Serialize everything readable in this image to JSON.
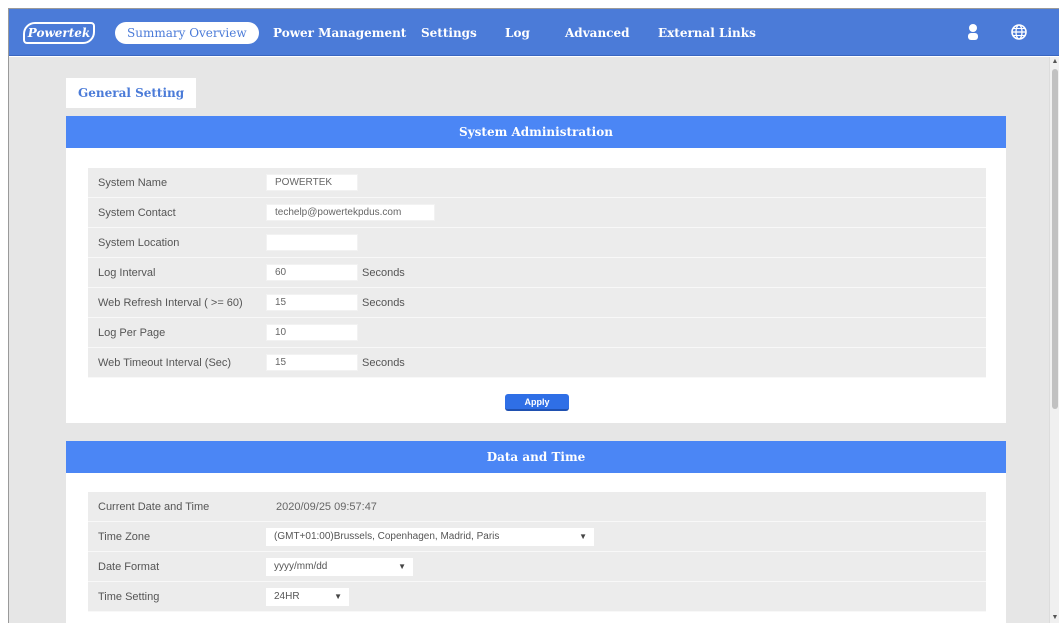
{
  "brand": {
    "logo_text": "Powertek"
  },
  "nav": {
    "items": [
      {
        "label": "Summary Overview"
      },
      {
        "label": "Power Management"
      },
      {
        "label": "Settings"
      },
      {
        "label": "Log"
      },
      {
        "label": "Advanced"
      },
      {
        "label": "External Links"
      }
    ],
    "active_index": 0,
    "icons": [
      "user-icon",
      "globe-icon"
    ]
  },
  "page": {
    "tab_label": "General Setting"
  },
  "system_admin": {
    "title": "System Administration",
    "rows": [
      {
        "label": "System Name",
        "value": "POWERTEK"
      },
      {
        "label": "System Contact",
        "value": "techelp@powertekpdus.com"
      },
      {
        "label": "System Location",
        "value": ""
      },
      {
        "label": "Log Interval",
        "value": "60",
        "unit": "Seconds"
      },
      {
        "label": "Web Refresh Interval ( >= 60)",
        "value": "15",
        "unit": "Seconds"
      },
      {
        "label": "Log Per Page",
        "value": "10"
      },
      {
        "label": "Web Timeout Interval (Sec)",
        "value": "15",
        "unit": "Seconds"
      }
    ],
    "apply_label": "Apply"
  },
  "date_time": {
    "title": "Data and Time",
    "rows": [
      {
        "label": "Current Date and Time",
        "value": "2020/09/25 09:57:47"
      },
      {
        "label": "Time Zone",
        "value": "(GMT+01:00)Brussels, Copenhagen, Madrid, Paris"
      },
      {
        "label": "Date Format",
        "value": "yyyy/mm/dd"
      },
      {
        "label": "Time Setting",
        "value": "24HR"
      }
    ]
  },
  "colors": {
    "header_blue": "#4b7bd8",
    "panel_header_blue": "#4b86f5",
    "apply_button": "#2f6fe6"
  }
}
